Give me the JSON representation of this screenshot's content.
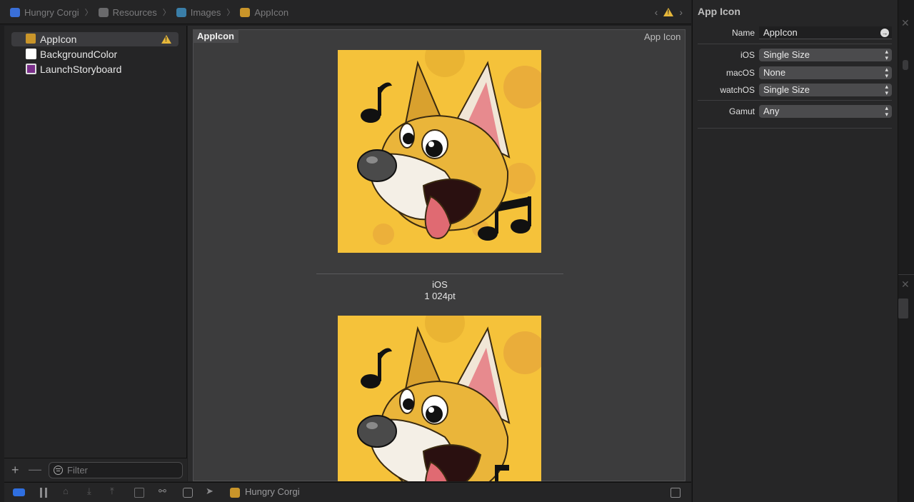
{
  "breadcrumb": {
    "items": [
      "Hungry Corgi",
      "Resources",
      "Images",
      "AppIcon"
    ]
  },
  "navigator": {
    "items": [
      {
        "label": "AppIcon",
        "selected": true,
        "warning": true
      },
      {
        "label": "BackgroundColor",
        "selected": false,
        "warning": false
      },
      {
        "label": "LaunchStoryboard",
        "selected": false,
        "warning": false
      }
    ],
    "filter_placeholder": "Filter"
  },
  "editor": {
    "set_name": "AppIcon",
    "set_kind": "App Icon",
    "slot": {
      "platform": "iOS",
      "size": "1 024pt"
    }
  },
  "bottom_bar": {
    "scheme_label": "Hungry Corgi"
  },
  "inspector": {
    "title": "App Icon",
    "name_label": "Name",
    "name_value": "AppIcon",
    "ios_label": "iOS",
    "ios_value": "Single Size",
    "macos_label": "macOS",
    "macos_value": "None",
    "watchos_label": "watchOS",
    "watchos_value": "Single Size",
    "gamut_label": "Gamut",
    "gamut_value": "Any"
  },
  "colors": {
    "accent": "#2f6fe0",
    "warning": "#e6b73a",
    "icon_bg": "#f5c23a",
    "launch_swatch": "#7a2f8a"
  }
}
